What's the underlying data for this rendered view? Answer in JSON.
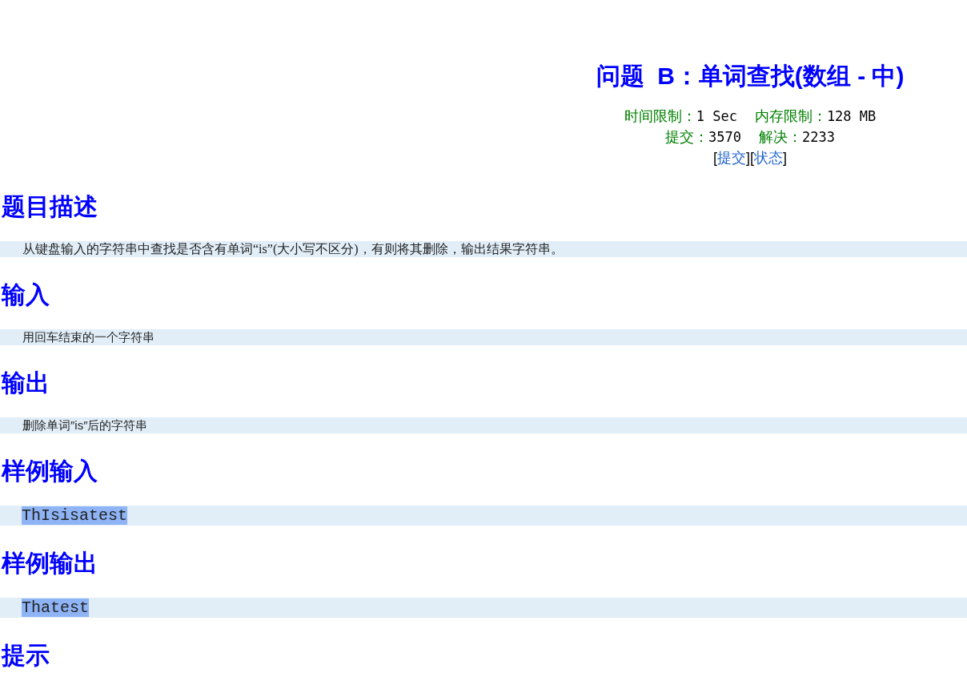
{
  "title": "问题  B：单词查找(数组 - 中)",
  "stats": [
    [
      {
        "label": "时间限制：",
        "value": "1 Sec"
      },
      {
        "label": "内存限制：",
        "value": "128 MB"
      }
    ],
    [
      {
        "label": "提交：",
        "value": "3570"
      },
      {
        "label": "解决：",
        "value": "2233"
      }
    ]
  ],
  "links": [
    {
      "kind": "bracket",
      "text": "["
    },
    {
      "kind": "link",
      "text": "提交"
    },
    {
      "kind": "bracket",
      "text": "]["
    },
    {
      "kind": "link",
      "text": "状态"
    },
    {
      "kind": "bracket",
      "text": "]"
    }
  ],
  "sections": [
    {
      "heading": "题目描述",
      "kind": "serif",
      "content": "从键盘输入的字符串中查找是否含有单词“is”(大小写不区分)，有则将其删除，输出结果字符串。"
    },
    {
      "heading": "输入",
      "kind": "plain",
      "content": "用回车结束的一个字符串"
    },
    {
      "heading": "输出",
      "kind": "plain",
      "content": "删除单词″is″后的字符串"
    },
    {
      "heading": "样例输入",
      "kind": "sample",
      "content": "ThIsisatest",
      "highlighted": true
    },
    {
      "heading": "样例输出",
      "kind": "sample",
      "content": "Thatest",
      "highlighted": true
    },
    {
      "heading": "提示"
    }
  ]
}
